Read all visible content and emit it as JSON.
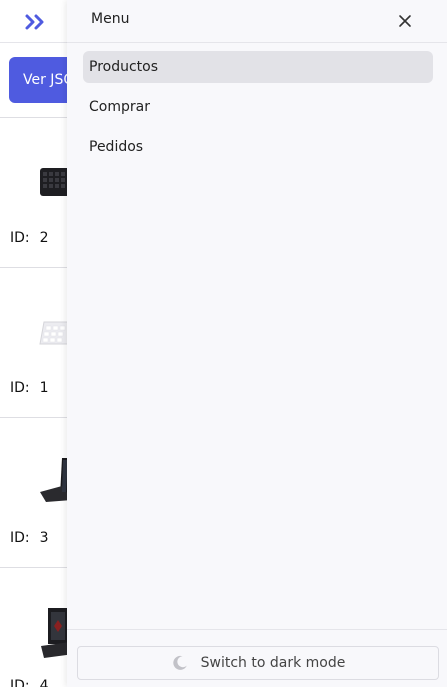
{
  "header": {
    "logo_icon": "double-chevron-right-icon",
    "brand_color": "#4f5be0"
  },
  "toolbar": {
    "json_button_label": "Ver JSON"
  },
  "products": [
    {
      "id_label": "ID:",
      "id_value": "2",
      "image": "black-keyboard"
    },
    {
      "id_label": "ID:",
      "id_value": "1",
      "image": "white-keyboard"
    },
    {
      "id_label": "ID:",
      "id_value": "3",
      "image": "black-laptop"
    },
    {
      "id_label": "ID:",
      "id_value": "4",
      "image": "gaming-laptop"
    }
  ],
  "drawer": {
    "title": "Menu",
    "close_icon": "close-icon",
    "items": [
      {
        "label": "Productos",
        "active": true
      },
      {
        "label": "Comprar",
        "active": false
      },
      {
        "label": "Pedidos",
        "active": false
      }
    ],
    "dark_mode_label": "Switch to dark mode",
    "dark_mode_icon": "moon-icon"
  }
}
